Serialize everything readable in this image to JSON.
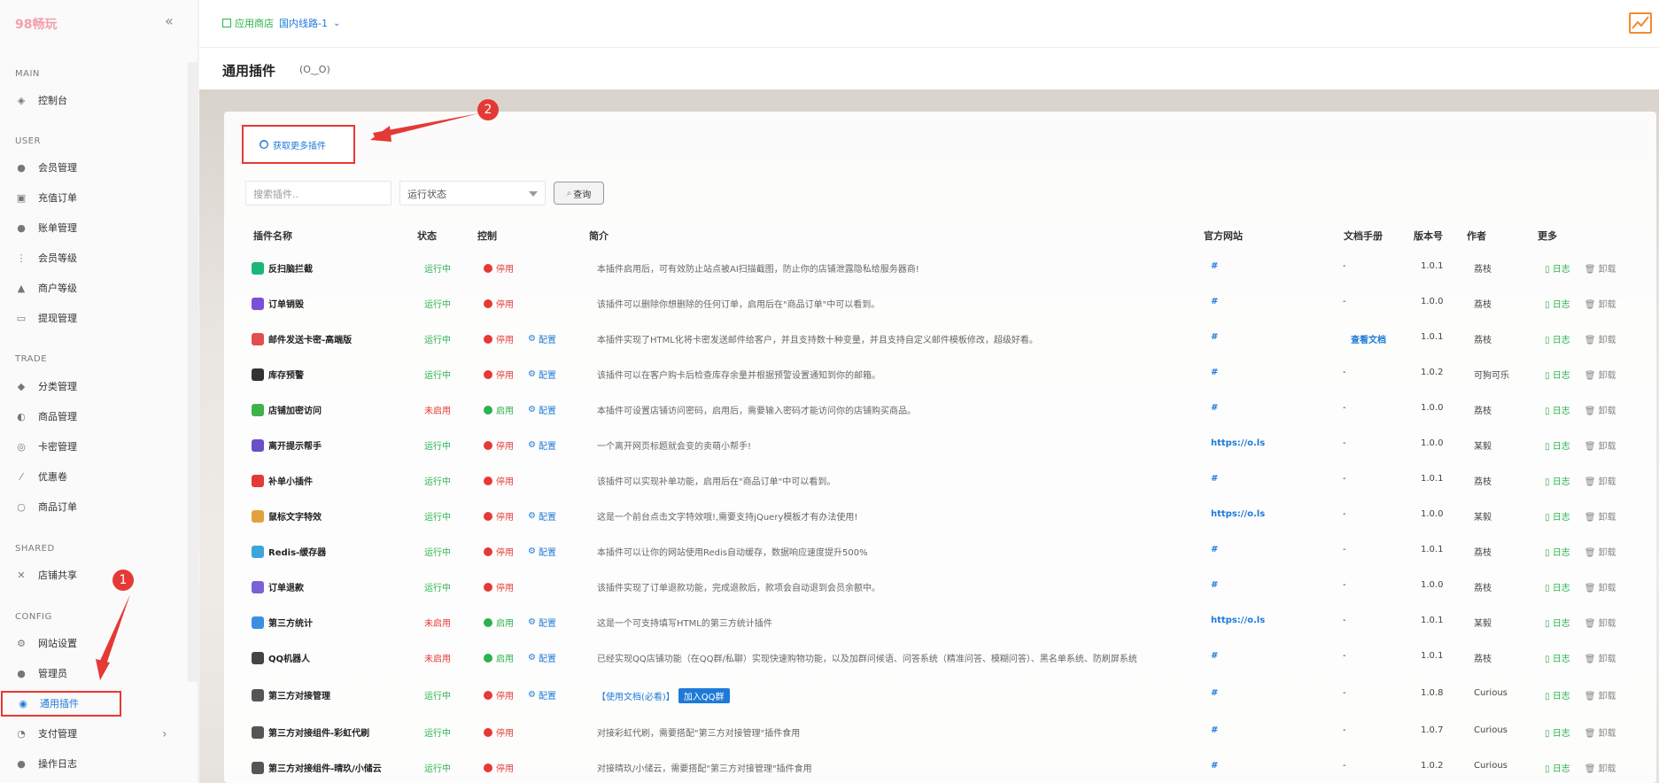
{
  "app": {
    "logo": "98畅玩"
  },
  "header": {
    "store_label": "应用商店",
    "line_label": "国内线路-1"
  },
  "page": {
    "title": "通用插件",
    "emoticon": "(O‿O)"
  },
  "sidebar": {
    "sections": [
      "MAIN",
      "USER",
      "TRADE",
      "SHARED",
      "CONFIG"
    ],
    "items": [
      "控制台",
      "会员管理",
      "充值订单",
      "账单管理",
      "会员等级",
      "商户等级",
      "提现管理",
      "分类管理",
      "商品管理",
      "卡密管理",
      "优惠卷",
      "商品订单",
      "店铺共享",
      "网站设置",
      "管理员",
      "通用插件",
      "支付管理",
      "操作日志"
    ]
  },
  "toolbar": {
    "more_plugins": "获取更多插件",
    "search_placeholder": "搜索插件..",
    "status_select": "运行状态",
    "query": "查询"
  },
  "table": {
    "headers": [
      "插件名称",
      "状态",
      "控制",
      "简介",
      "官方网站",
      "文档手册",
      "版本号",
      "作者",
      "更多"
    ],
    "rows": [
      {
        "name": "反扫脑拦截",
        "state": "运行中",
        "toggle": "停用",
        "config": "",
        "desc": "本插件启用后，可有效防止站点被AI扫描截图，防止你的店铺泄露隐私给服务器商!",
        "site": "#",
        "doc": "-",
        "ver": "1.0.1",
        "author": "荔枝"
      },
      {
        "name": "订单销毁",
        "state": "运行中",
        "toggle": "停用",
        "config": "",
        "desc": "该插件可以删除你想删除的任何订单，启用后在\"商品订单\"中可以看到。",
        "site": "#",
        "doc": "-",
        "ver": "1.0.0",
        "author": "荔枝"
      },
      {
        "name": "邮件发送卡密-高端版",
        "state": "运行中",
        "toggle": "停用",
        "config": "配置",
        "desc": "本插件实现了HTML化将卡密发送邮件给客户，并且支持数十种变量，并且支持自定义邮件模板修改，超级好看。",
        "site": "#",
        "doc": "查看文档",
        "ver": "1.0.1",
        "author": "荔枝"
      },
      {
        "name": "库存预警",
        "state": "运行中",
        "toggle": "停用",
        "config": "配置",
        "desc": "该插件可以在客户购卡后检查库存余量并根据预警设置通知到你的邮箱。",
        "site": "#",
        "doc": "-",
        "ver": "1.0.2",
        "author": "可狗可乐"
      },
      {
        "name": "店铺加密访问",
        "state": "未启用",
        "toggle": "启用",
        "config": "配置",
        "desc": "本插件可设置店铺访问密码，启用后，需要输入密码才能访问你的店铺购买商品。",
        "site": "#",
        "doc": "-",
        "ver": "1.0.0",
        "author": "荔枝"
      },
      {
        "name": "离开提示帮手",
        "state": "运行中",
        "toggle": "停用",
        "config": "配置",
        "desc": "一个离开网页标题就会变的卖萌小帮手!",
        "site": "https://o.ls",
        "doc": "-",
        "ver": "1.0.0",
        "author": "某毅"
      },
      {
        "name": "补单小插件",
        "state": "运行中",
        "toggle": "停用",
        "config": "",
        "desc": "该插件可以实现补单功能，启用后在\"商品订单\"中可以看到。",
        "site": "#",
        "doc": "-",
        "ver": "1.0.1",
        "author": "荔枝"
      },
      {
        "name": "鼠标文字特效",
        "state": "运行中",
        "toggle": "停用",
        "config": "配置",
        "desc": "这是一个前台点击文字特效哦!,需要支持jQuery模板才有办法使用!",
        "site": "https://o.ls",
        "doc": "-",
        "ver": "1.0.0",
        "author": "某毅"
      },
      {
        "name": "Redis-缓存器",
        "state": "运行中",
        "toggle": "停用",
        "config": "配置",
        "desc": "本插件可以让你的网站使用Redis自动缓存，数据响应速度提升500%",
        "site": "#",
        "doc": "-",
        "ver": "1.0.1",
        "author": "荔枝"
      },
      {
        "name": "订单退款",
        "state": "运行中",
        "toggle": "停用",
        "config": "",
        "desc": "该插件实现了订单退款功能，完成退款后，款项会自动退到会员余额中。",
        "site": "#",
        "doc": "-",
        "ver": "1.0.0",
        "author": "荔枝"
      },
      {
        "name": "第三方统计",
        "state": "未启用",
        "toggle": "启用",
        "config": "配置",
        "desc": "这是一个可支持填写HTML的第三方统计插件",
        "site": "https://o.ls",
        "doc": "-",
        "ver": "1.0.1",
        "author": "某毅"
      },
      {
        "name": "QQ机器人",
        "state": "未启用",
        "toggle": "启用",
        "config": "配置",
        "desc": "已经实现QQ店铺功能（在QQ群/私聊）实现快速购物功能，以及加群问候语、问答系统（精准问答、模糊问答）、黑名单系统、防刷屏系统",
        "site": "#",
        "doc": "-",
        "ver": "1.0.1",
        "author": "荔枝"
      },
      {
        "name": "第三方对接管理",
        "state": "运行中",
        "toggle": "停用",
        "config": "配置",
        "desc": "【使用文档(必看)】",
        "desc_btn": "加入QQ群",
        "site": "#",
        "doc": "-",
        "ver": "1.0.8",
        "author": "Curious"
      },
      {
        "name": "第三方对接组件-彩虹代刷",
        "state": "运行中",
        "toggle": "停用",
        "config": "",
        "desc": "对接彩虹代刷，需要搭配\"第三方对接管理\"插件食用",
        "site": "#",
        "doc": "-",
        "ver": "1.0.7",
        "author": "Curious"
      },
      {
        "name": "第三方对接组件-晴玖/小储云",
        "state": "运行中",
        "toggle": "停用",
        "config": "",
        "desc": "对接晴玖/小储云，需要搭配\"第三方对接管理\"插件食用",
        "site": "#",
        "doc": "-",
        "ver": "1.0.2",
        "author": "Curious"
      }
    ],
    "more_log": "日志",
    "more_uninstall": "卸载"
  },
  "annotations": {
    "one": "1",
    "two": "2"
  }
}
